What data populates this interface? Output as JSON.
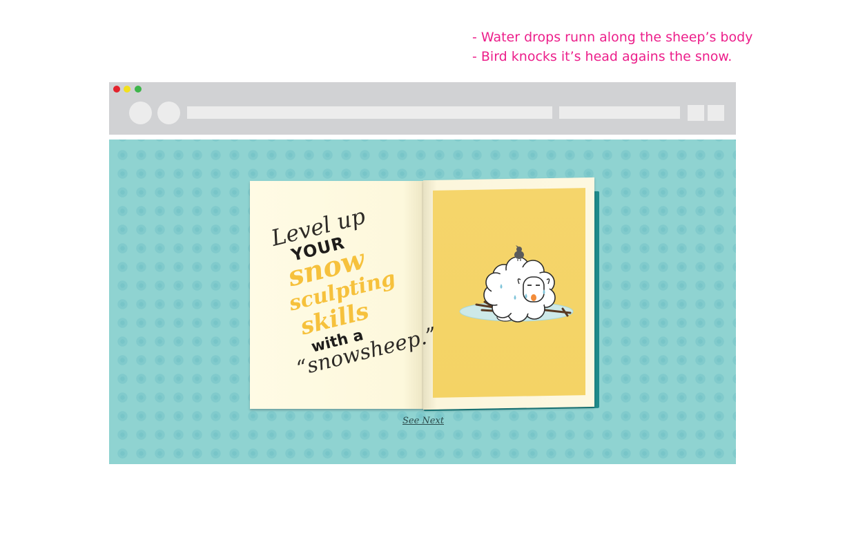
{
  "notes": [
    "- Water drops runn along the sheep’s body",
    "- Bird knocks it’s head agains the snow."
  ],
  "browser": {
    "window_buttons": [
      "close",
      "minimize",
      "maximize"
    ],
    "colors": {
      "chrome": "#d1d2d4",
      "background": "#8fd3d1",
      "accent_note": "#ec1e8a"
    }
  },
  "card": {
    "headline_lines": [
      "Level up",
      "YOUR",
      "snow",
      "sculpting",
      "skills",
      "with a",
      "“snowsheep.”"
    ],
    "illustration": "snow-sheep-with-bird",
    "see_next": "See Next"
  }
}
